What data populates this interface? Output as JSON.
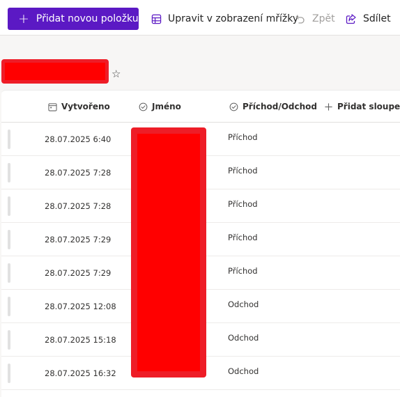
{
  "toolbar": {
    "new_item_label": "Přidat novou položku",
    "grid_edit_label": "Upravit v zobrazení mřížky",
    "undo_label": "Zpět",
    "share_label": "Sdílet"
  },
  "columns": {
    "created": "Vytvořeno",
    "name": "Jméno",
    "arrival": "Příchod/Odchod",
    "add_column": "Přidat sloupec"
  },
  "rows": [
    {
      "created": "28.07.2025 6:40",
      "status": "Příchod"
    },
    {
      "created": "28.07.2025 7:28",
      "status": "Příchod"
    },
    {
      "created": "28.07.2025 7:28",
      "status": "Příchod"
    },
    {
      "created": "28.07.2025 7:29",
      "status": "Příchod"
    },
    {
      "created": "28.07.2025 7:29",
      "status": "Příchod"
    },
    {
      "created": "28.07.2025 12:08",
      "status": "Odchod"
    },
    {
      "created": "28.07.2025 15:18",
      "status": "Odchod"
    },
    {
      "created": "28.07.2025 16:32",
      "status": "Odchod"
    }
  ],
  "colors": {
    "accent": "#5b19c4",
    "redaction": "#ff0000"
  },
  "icons": [
    "plus-icon",
    "grid-icon",
    "undo-icon",
    "share-icon",
    "star-icon",
    "calendar-icon",
    "check-circle-icon"
  ]
}
